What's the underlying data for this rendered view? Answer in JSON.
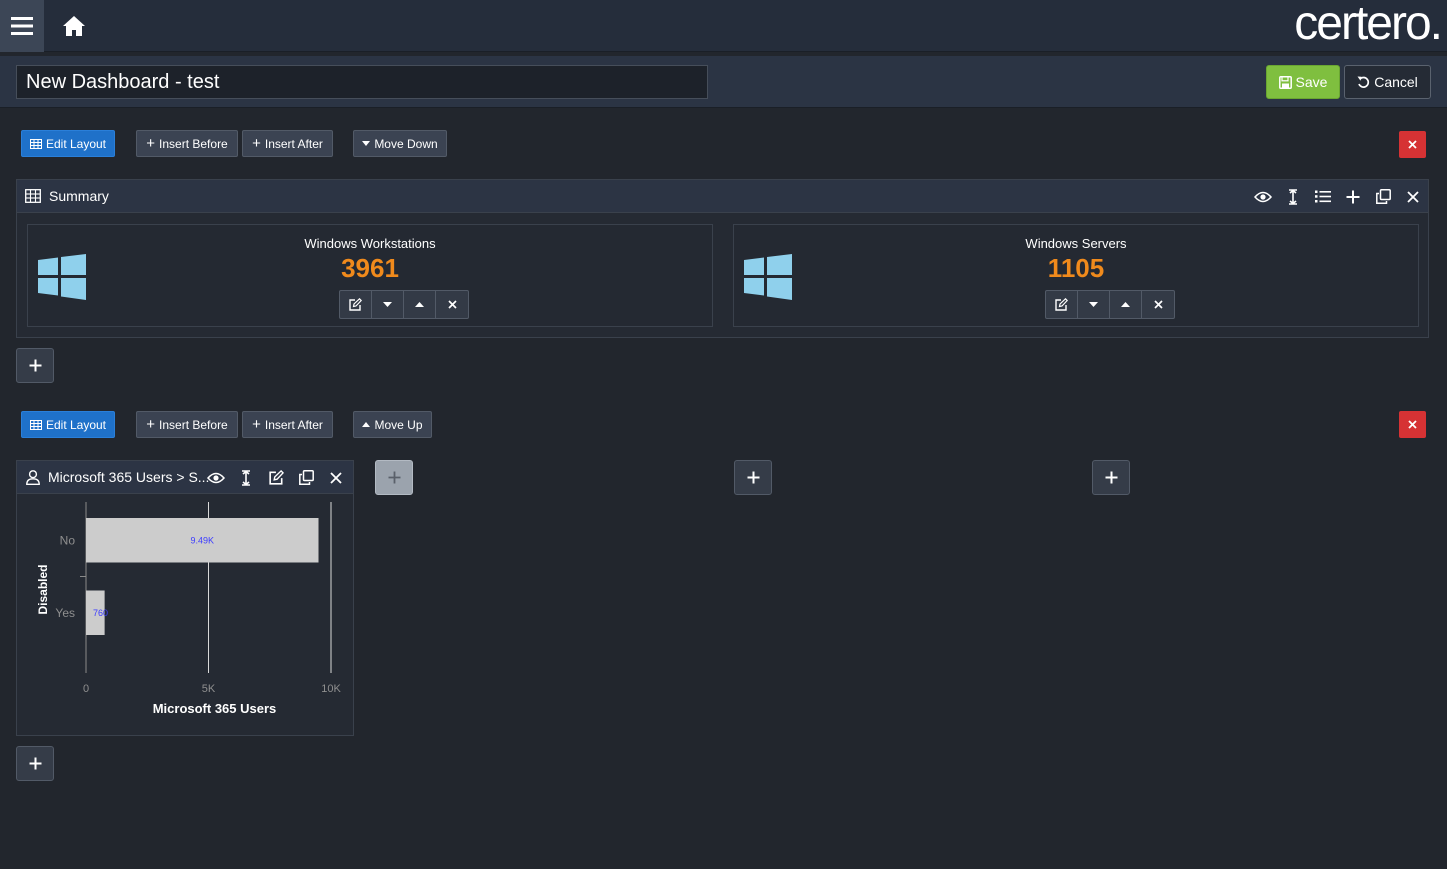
{
  "brand": "certero.",
  "title_input": {
    "value": "New Dashboard - test"
  },
  "actions": {
    "save_label": "Save",
    "cancel_label": "Cancel"
  },
  "row1": {
    "toolbar": {
      "edit_layout": "Edit Layout",
      "insert_before": "Insert Before",
      "insert_after": "Insert After",
      "move": "Move Down"
    },
    "panel_title": "Summary",
    "kpis": [
      {
        "label": "Windows Workstations",
        "value": "3961"
      },
      {
        "label": "Windows Servers",
        "value": "1105"
      }
    ]
  },
  "row2": {
    "toolbar": {
      "edit_layout": "Edit Layout",
      "insert_before": "Insert Before",
      "insert_after": "Insert After",
      "move": "Move Up"
    },
    "panel_title": "Microsoft 365 Users > S..."
  },
  "colors": {
    "accent": "#1f71c9",
    "save": "#7fbf3f",
    "danger": "#d63234",
    "kpi": "#f08a1c",
    "windows_logo": "#8fd0ec"
  },
  "chart_data": {
    "type": "bar",
    "orientation": "horizontal",
    "categories": [
      "No",
      "Yes"
    ],
    "values": [
      9490,
      760
    ],
    "data_labels": [
      "9.49K",
      "760"
    ],
    "xlabel": "Microsoft 365 Users",
    "ylabel": "Disabled",
    "xlim": [
      0,
      10000
    ],
    "xticks": [
      0,
      5000,
      10000
    ],
    "xtick_labels": [
      "0",
      "5K",
      "10K"
    ],
    "bar_color": "#cccccc",
    "label_color": "#3c3cff",
    "grid": true
  }
}
